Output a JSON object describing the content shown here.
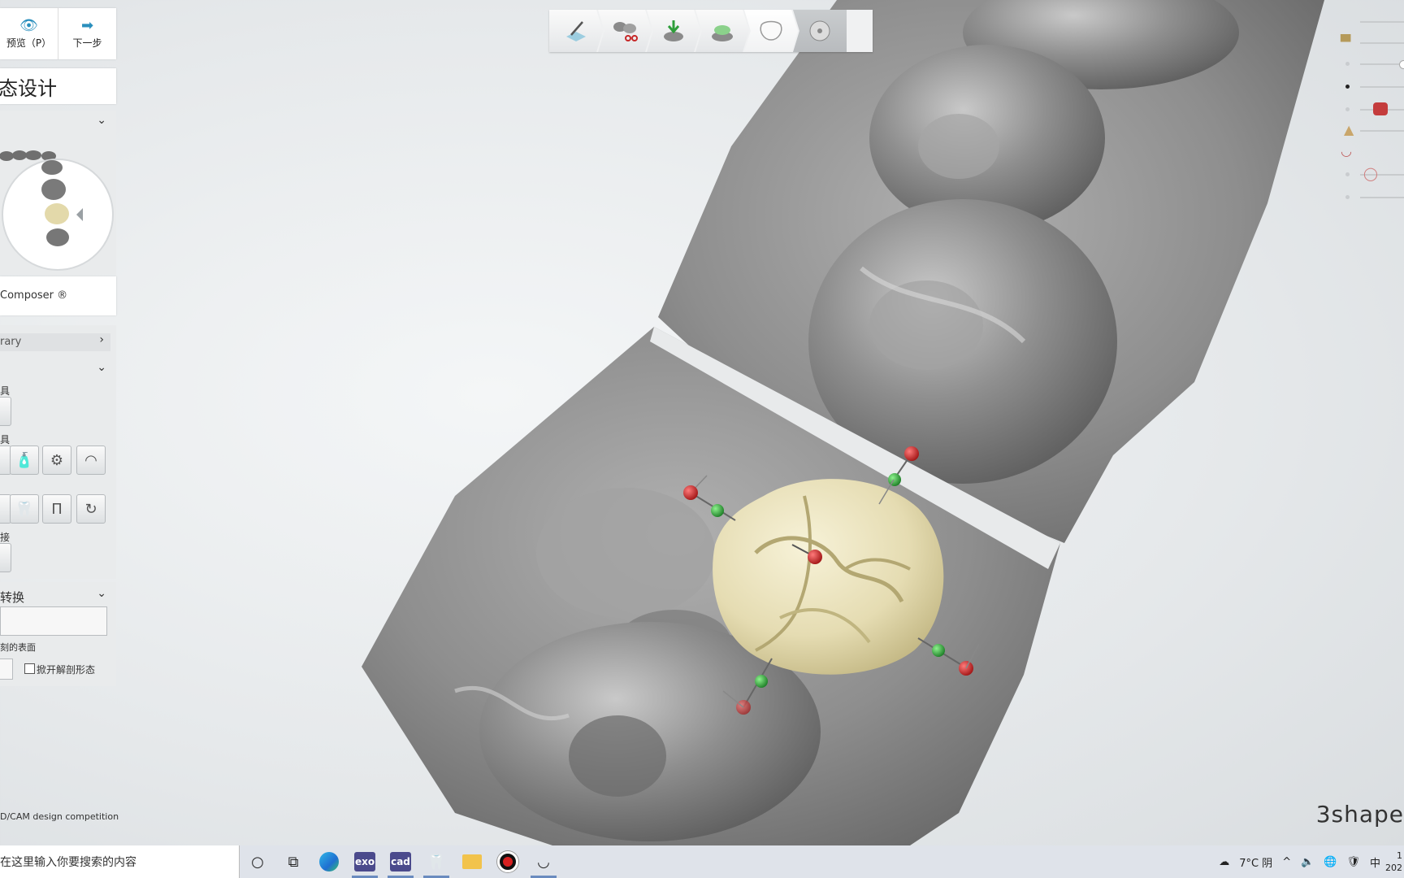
{
  "left_panel": {
    "preview_label": "预览（P）",
    "next_label": "下一步",
    "title": "态设计",
    "composer_label": "Composer ®",
    "library_label": "rary",
    "tools_label_1": "具",
    "tools_label_2": "具",
    "tools_label_3": "接",
    "transform_label": "转换",
    "surface_label": "刻的表面",
    "checkbox_label": "掀开解剖形态"
  },
  "toolbar": {
    "steps": [
      "marking-icon",
      "scissors-icon",
      "model-download-icon",
      "crown-base-icon",
      "tooth-icon",
      "disc-icon"
    ],
    "active_step": 4
  },
  "brand": "3shape",
  "contest_text": "D/CAM design competition",
  "taskbar": {
    "search_placeholder": "在这里输入你要搜索的内容",
    "apps": [
      {
        "label": "exo",
        "color": "#4b4a8c"
      },
      {
        "label": "cad",
        "color": "#4b4a8c"
      }
    ],
    "weather": "7°C 阴",
    "ime": "中",
    "clock_time": "1",
    "clock_date": "202"
  },
  "colors": {
    "crown": "#e9e1bc",
    "teeth": "#8d8d8d",
    "handle_red": "#c62828",
    "handle_green": "#2e9e3a"
  }
}
